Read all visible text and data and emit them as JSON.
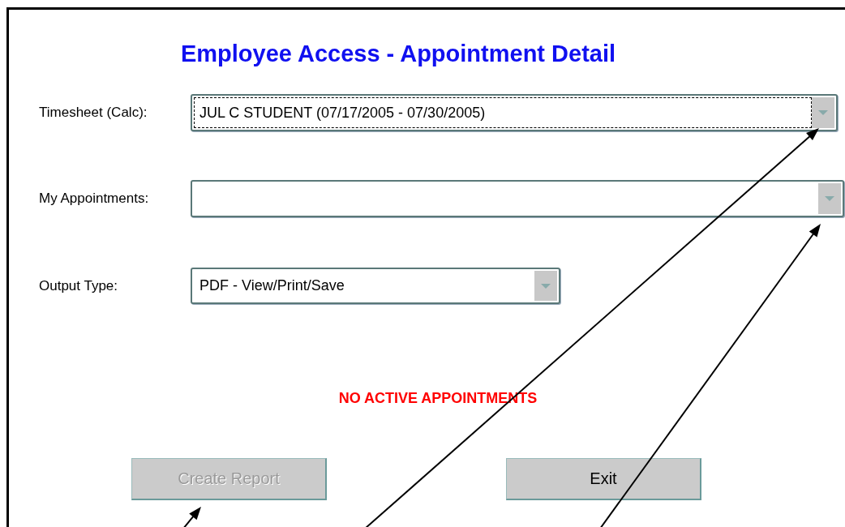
{
  "title": "Employee Access - Appointment Detail",
  "fields": [
    {
      "label": "Timesheet (Calc):",
      "value": "JUL C STUDENT (07/17/2005 - 07/30/2005)",
      "focused": true
    },
    {
      "label": "My Appointments:",
      "focused": false
    },
    {
      "label": "Output Type:",
      "value": "PDF - View/Print/Save",
      "focused": false
    }
  ],
  "message": "NO ACTIVE APPOINTMENTS",
  "buttons": [
    {
      "label": "Create Report",
      "disabled": true
    },
    {
      "label": "Exit",
      "disabled": false
    }
  ]
}
